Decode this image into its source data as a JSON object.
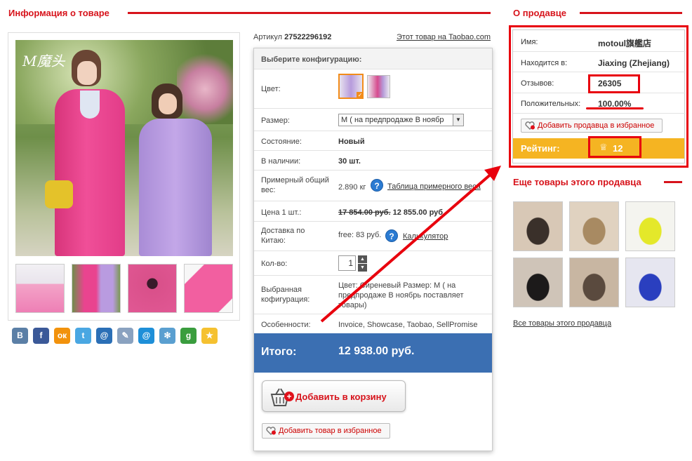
{
  "product_info": {
    "title": "Информация о товаре",
    "article_label": "Артикул",
    "article_number": "27522296192",
    "taobao_link": "Этот товар на Taobao.com",
    "brand_logo": "M魔头"
  },
  "thumbnails": [
    {
      "name": "thumb-1",
      "color": "#e8ecf2"
    },
    {
      "name": "thumb-2",
      "color": "#6f8e4b"
    },
    {
      "name": "thumb-3",
      "color": "#d9508a"
    },
    {
      "name": "thumb-4",
      "color": "#f25fa0"
    }
  ],
  "social": [
    {
      "name": "vk-icon",
      "glyph": "В",
      "color": "#5b7fa6"
    },
    {
      "name": "facebook-icon",
      "glyph": "f",
      "color": "#3b5998"
    },
    {
      "name": "odnoklassniki-icon",
      "glyph": "ок",
      "color": "#f2920c"
    },
    {
      "name": "twitter-icon",
      "glyph": "t",
      "color": "#4aa7e2"
    },
    {
      "name": "moimir-icon",
      "glyph": "@",
      "color": "#2b6fb6"
    },
    {
      "name": "livejournal-icon",
      "glyph": "✎",
      "color": "#8aa2c0"
    },
    {
      "name": "mailru-icon",
      "glyph": "@",
      "color": "#1e8fd8"
    },
    {
      "name": "settings-icon",
      "glyph": "✻",
      "color": "#5a9fd0"
    },
    {
      "name": "google-icon",
      "glyph": "g",
      "color": "#3a9d3e"
    },
    {
      "name": "favorite-star-icon",
      "glyph": "★",
      "color": "#f5c130"
    }
  ],
  "config": {
    "header": "Выберите конфигурацию:",
    "color_label": "Цвет:",
    "size_label": "Размер:",
    "size_value": "M ( на предпродаже В ноябр",
    "condition_label": "Состояние:",
    "condition_value": "Новый",
    "stock_label": "В наличии:",
    "stock_value": "30 шт.",
    "weight_label": "Примерный общий вес:",
    "weight_value": "2.890 кг",
    "weight_table_link": "Таблица примерного веса",
    "price_label": "Цена 1 шт.:",
    "price_old": "17 854.00 руб.",
    "price_new": "12 855.00 руб.",
    "delivery_label": "Доставка по Китаю:",
    "delivery_value": "free: 83 руб.",
    "calculator_link": "Калькулятор",
    "qty_label": "Кол-во:",
    "qty_value": "1",
    "selected_label": "Выбранная кофигурация:",
    "selected_value": "Цвет: Сиреневый Размер: M ( на предпродаже В ноябрь поставляет товары)",
    "features_label": "Особенности:",
    "features_value": "Invoice, Showcase, Taobao, SellPromise",
    "total_label": "Итого:",
    "total_value": "12 938.00 руб.",
    "cart_button": "Добавить в корзину",
    "fav_product_button": "Добавить товар в избранное",
    "colors": {
      "primary": "#3b6fb2",
      "accent": "#d7131b"
    }
  },
  "seller": {
    "title": "О продавце",
    "name_label": "Имя:",
    "name_value": "motoul旗艦店",
    "location_label": "Находится в:",
    "location_value": "Jiaxing (Zhejiang)",
    "reviews_label": "Отзывов:",
    "reviews_value": "26305",
    "positive_label": "Положительных:",
    "positive_value": "100.00%",
    "fav_seller_button": "Добавить продавца в избранное",
    "rating_label": "Рейтинг:",
    "rating_value": "12",
    "rating_icon": "♕"
  },
  "more": {
    "title": "Еще товары этого продавца",
    "all_link": "Все товары этого продавца",
    "items": [
      {
        "name": "seller-product-1",
        "c1": "#d8c8b6",
        "c2": "#3a302a"
      },
      {
        "name": "seller-product-2",
        "c1": "#e0d2c0",
        "c2": "#a88a62"
      },
      {
        "name": "seller-product-3",
        "c1": "#f4f4ef",
        "c2": "#e4e82a"
      },
      {
        "name": "seller-product-4",
        "c1": "#cfc4b8",
        "c2": "#1c1a1a"
      },
      {
        "name": "seller-product-5",
        "c1": "#c8b6a2",
        "c2": "#5a4a3e"
      },
      {
        "name": "seller-product-6",
        "c1": "#e6e6f0",
        "c2": "#2a3fbf"
      }
    ]
  }
}
